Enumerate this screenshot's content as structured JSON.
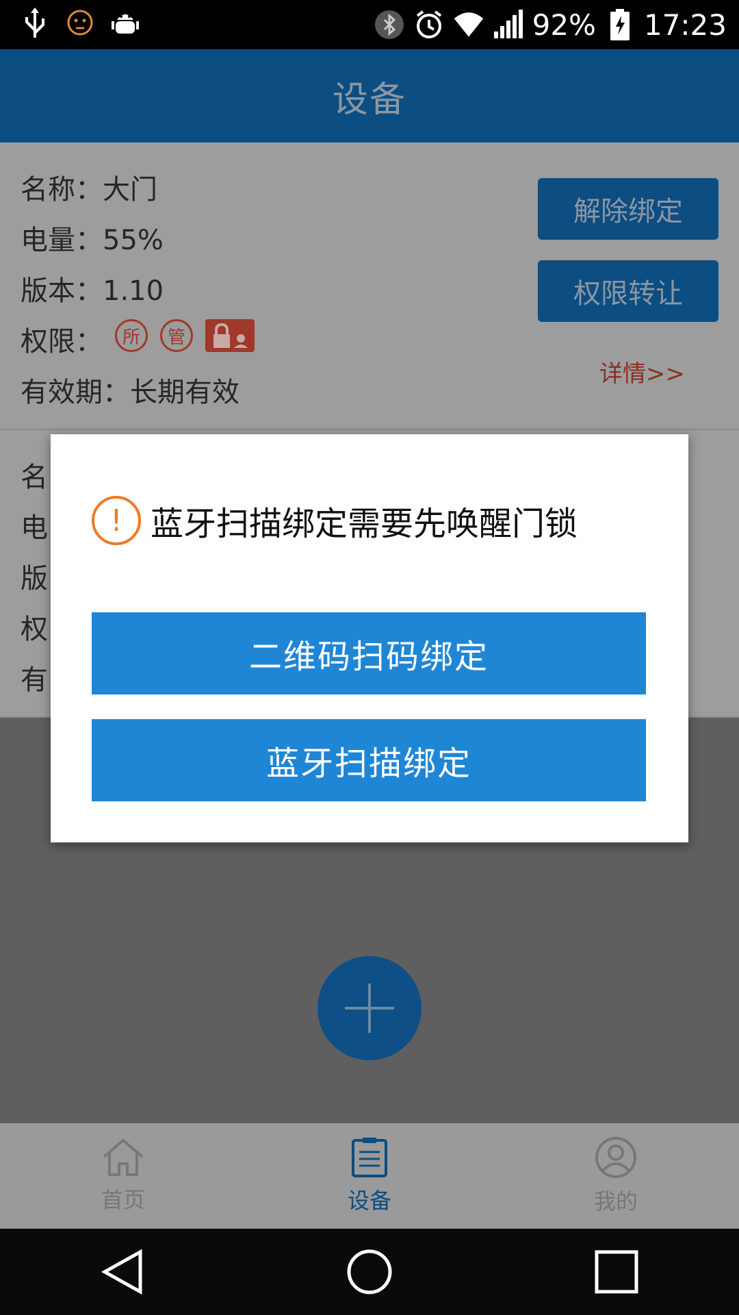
{
  "status_bar": {
    "battery": "92%",
    "time": "17:23",
    "icons": [
      "usb-icon",
      "face-icon",
      "android-debug-icon",
      "bluetooth-icon",
      "alarm-icon",
      "wifi-icon",
      "signal-icon",
      "battery-charging-icon"
    ]
  },
  "header": {
    "title": "设备"
  },
  "device_card": {
    "name": "名称：大门",
    "battery": "电量：55%",
    "version": "版本：1.10",
    "permission_label": "权限：",
    "badge_owner": "所",
    "badge_admin": "管",
    "validity": "有效期：长期有效",
    "unbind_button": "解除绑定",
    "transfer_button": "权限转让",
    "detail_link": "详情>>"
  },
  "device_card2_labels": [
    "名",
    "电",
    "版",
    "权",
    "有"
  ],
  "dialog": {
    "message": "蓝牙扫描绑定需要先唤醒门锁",
    "qr_button": "二维码扫码绑定",
    "bluetooth_button": "蓝牙扫描绑定"
  },
  "bottom_nav": {
    "items": [
      {
        "label": "首页",
        "icon": "home-icon"
      },
      {
        "label": "设备",
        "icon": "list-icon"
      },
      {
        "label": "我的",
        "icon": "user-icon"
      }
    ],
    "active": "设备"
  },
  "colors": {
    "primary": "#1f86d6",
    "header": "#0c4d82",
    "warning": "#f07a22",
    "badge": "#a1382a"
  }
}
